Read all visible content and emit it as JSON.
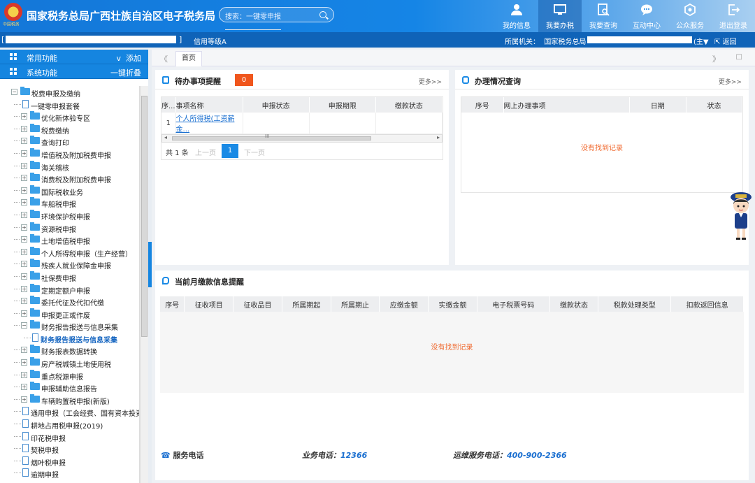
{
  "header": {
    "logo_text": "中国税务",
    "title": "国家税务总局广西壮族自治区电子税务局",
    "search_placeholder": "搜索：一键零申报",
    "nav": [
      {
        "label": "我的信息",
        "icon": "user-icon"
      },
      {
        "label": "我要办税",
        "icon": "monitor-icon"
      },
      {
        "label": "我要查询",
        "icon": "query-icon"
      },
      {
        "label": "互动中心",
        "icon": "chat-icon"
      },
      {
        "label": "公众服务",
        "icon": "service-icon"
      },
      {
        "label": "退出登录",
        "icon": "logout-icon"
      }
    ]
  },
  "subbar": {
    "bracket_open": "[",
    "bracket_close": "]",
    "credit": "信用等级A",
    "org_label": "所属机关：",
    "org_prefix": "国家税务总局",
    "main_label": "(主▼",
    "return_label": "返回"
  },
  "sidebar": {
    "common": "常用功能",
    "add": "添加",
    "system": "系统功能",
    "collapse": "一键折叠",
    "tree": [
      {
        "label": "税费申报及缴纳",
        "type": "folder",
        "level": 0,
        "pm": "−"
      },
      {
        "label": "一键零申报套餐",
        "type": "doc",
        "level": 1
      },
      {
        "label": "优化新体验专区",
        "type": "folder",
        "level": 1,
        "pm": "+"
      },
      {
        "label": "税费缴纳",
        "type": "folder",
        "level": 1,
        "pm": "+"
      },
      {
        "label": "查询打印",
        "type": "folder",
        "level": 1,
        "pm": "+"
      },
      {
        "label": "增值税及附加税费申报",
        "type": "folder",
        "level": 1,
        "pm": "+"
      },
      {
        "label": "海关稽核",
        "type": "folder",
        "level": 1,
        "pm": "+"
      },
      {
        "label": "消费税及附加税费申报",
        "type": "folder",
        "level": 1,
        "pm": "+"
      },
      {
        "label": "国际税收业务",
        "type": "folder",
        "level": 1,
        "pm": "+"
      },
      {
        "label": "车船税申报",
        "type": "folder",
        "level": 1,
        "pm": "+"
      },
      {
        "label": "环境保护税申报",
        "type": "folder",
        "level": 1,
        "pm": "+"
      },
      {
        "label": "资源税申报",
        "type": "folder",
        "level": 1,
        "pm": "+"
      },
      {
        "label": "土地增值税申报",
        "type": "folder",
        "level": 1,
        "pm": "+"
      },
      {
        "label": "个人所得税申报（生产经营）",
        "type": "folder",
        "level": 1,
        "pm": "+"
      },
      {
        "label": "残疾人就业保障金申报",
        "type": "folder",
        "level": 1,
        "pm": "+"
      },
      {
        "label": "社保费申报",
        "type": "folder",
        "level": 1,
        "pm": "+"
      },
      {
        "label": "定期定额户申报",
        "type": "folder",
        "level": 1,
        "pm": "+"
      },
      {
        "label": "委托代征及代扣代缴",
        "type": "folder",
        "level": 1,
        "pm": "+"
      },
      {
        "label": "申报更正或作废",
        "type": "folder",
        "level": 1,
        "pm": "+"
      },
      {
        "label": "财务报告报送与信息采集",
        "type": "folder",
        "level": 1,
        "pm": "−"
      },
      {
        "label": "财务报告报送与信息采集",
        "type": "doc",
        "level": 2,
        "selected": true
      },
      {
        "label": "财务报表数据转换",
        "type": "folder",
        "level": 1,
        "pm": "+"
      },
      {
        "label": "房产税城镇土地使用税",
        "type": "folder",
        "level": 1,
        "pm": "+"
      },
      {
        "label": "重点税源申报",
        "type": "folder",
        "level": 1,
        "pm": "+"
      },
      {
        "label": "申报辅助信息报告",
        "type": "folder",
        "level": 1,
        "pm": "+"
      },
      {
        "label": "车辆购置税申报(新版)",
        "type": "folder",
        "level": 1,
        "pm": "+"
      },
      {
        "label": "通用申报（工会经费、国有资本投资",
        "type": "doc",
        "level": 1
      },
      {
        "label": "耕地占用税申报(2019)",
        "type": "doc",
        "level": 1
      },
      {
        "label": "印花税申报",
        "type": "doc",
        "level": 1
      },
      {
        "label": "契税申报",
        "type": "doc",
        "level": 1
      },
      {
        "label": "烟叶税申报",
        "type": "doc",
        "level": 1
      },
      {
        "label": "逾期申报",
        "type": "doc",
        "level": 1
      }
    ]
  },
  "tabs": {
    "home": "首页",
    "left_arrows": "《",
    "right_arrows": "》",
    "square": "□"
  },
  "todo": {
    "title": "待办事项提醒",
    "count": "0",
    "more": "更多>>",
    "columns": [
      "序...",
      "事项名称",
      "申报状态",
      "申报期限",
      "缴款状态"
    ],
    "rows": [
      [
        "1",
        "个人所得税(工资薪金...",
        "",
        "",
        ""
      ]
    ],
    "scroll_mark": "III",
    "total": "共 1 条",
    "prev": "上一页",
    "page": "1",
    "next": "下一页"
  },
  "query": {
    "title": "办理情况查询",
    "more": "更多>>",
    "columns": [
      "序号",
      "网上办理事项",
      "日期",
      "状态"
    ],
    "empty": "没有找到记录"
  },
  "payment": {
    "title": "当前月缴款信息提醒",
    "columns": [
      "序号",
      "征收项目",
      "征收品目",
      "所属期起",
      "所属期止",
      "应缴金额",
      "实缴金额",
      "电子税票号码",
      "缴款状态",
      "税款处理类型",
      "扣款返回信息"
    ],
    "empty": "没有找到记录"
  },
  "footer": {
    "service": "服务电话",
    "biz_label": "业务电话：",
    "biz_phone": "12366",
    "ops_label": "运维服务电话：",
    "ops_phone": "400-900-2366"
  }
}
